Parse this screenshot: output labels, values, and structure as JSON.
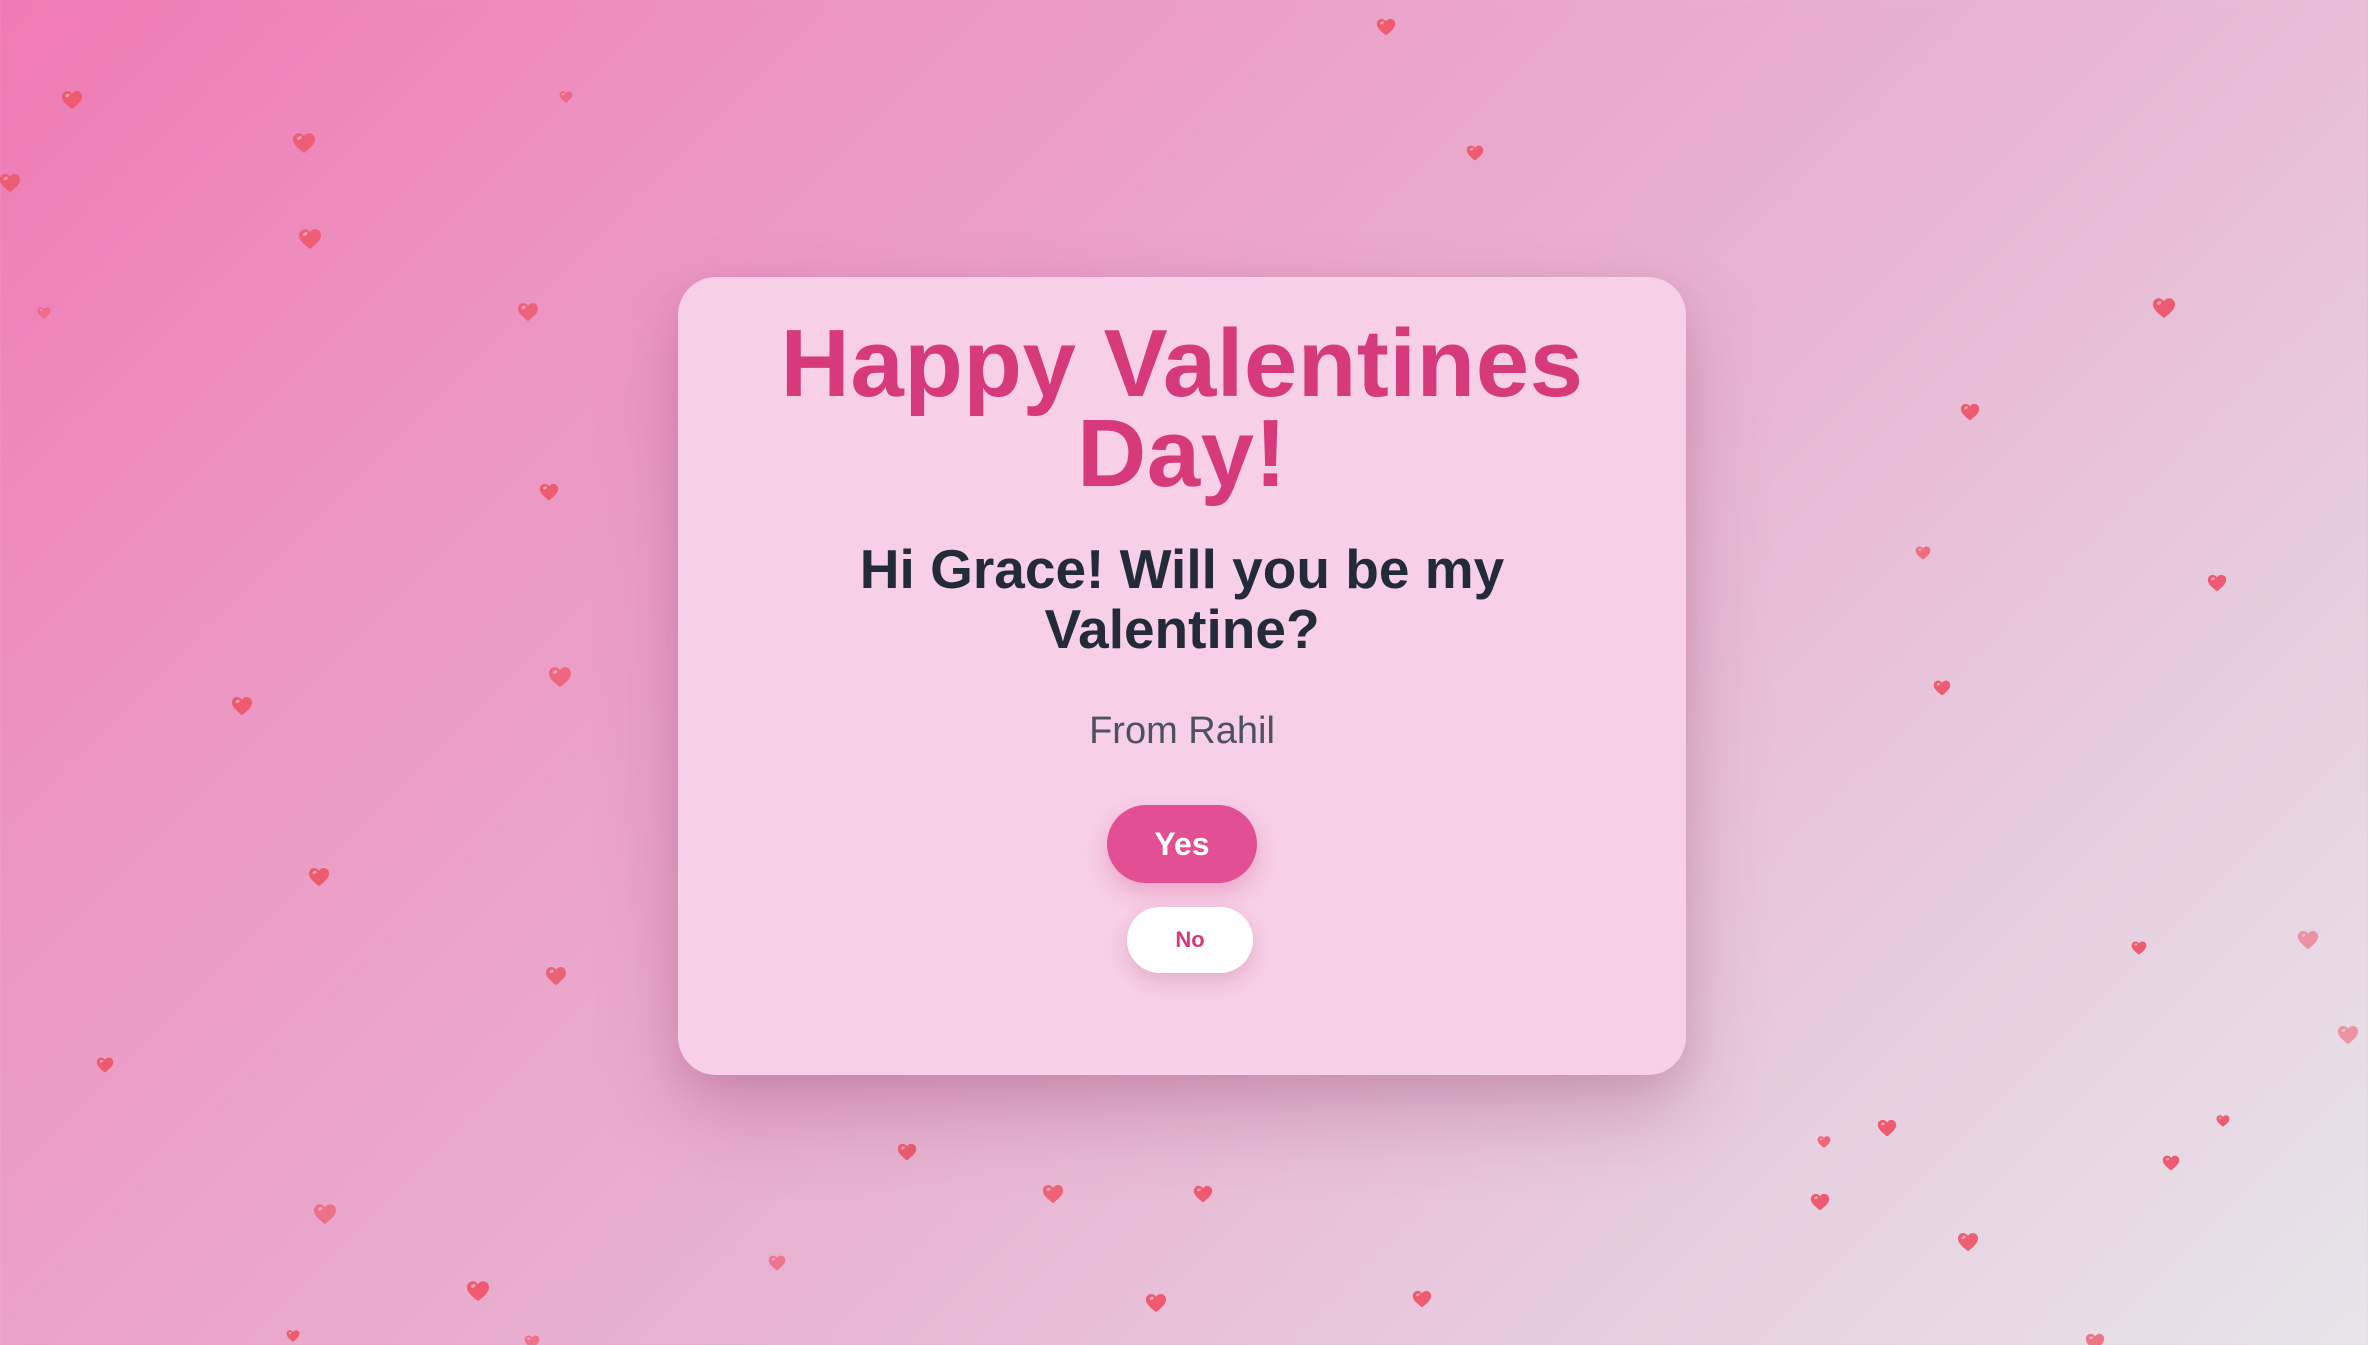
{
  "card": {
    "title_line1": "Happy Valentines",
    "title_line2": "Day!",
    "question_line1": "Hi Grace! Will you be my",
    "question_line2": "Valentine?",
    "from": "From Rahil",
    "yes_label": "Yes",
    "no_label": "No"
  },
  "icons": {
    "heart": "heart-icon"
  },
  "colors": {
    "accent": "#d63a7b",
    "yes_button": "#e24f93",
    "heart": "#ee5a6f"
  }
}
